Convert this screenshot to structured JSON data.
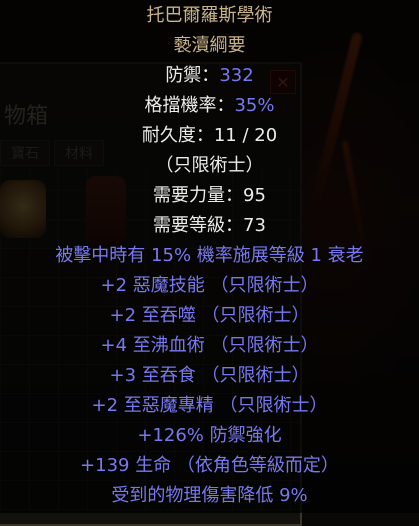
{
  "item": {
    "name": "托巴爾羅斯學術",
    "base_type": "褻瀆綱要",
    "defense_label": "防禦：",
    "defense_value": "332",
    "block_label": "格擋機率：",
    "block_value": "35%",
    "durability": "耐久度：11 / 20",
    "class_restriction": "（只限術士）",
    "required_strength": "需要力量：95",
    "required_level": "需要等級：73",
    "affixes": [
      "被擊中時有 15% 機率施展等級 1 衰老",
      "+2 惡魔技能 （只限術士）",
      "+2 至吞噬 （只限術士）",
      "+4 至沸血術 （只限術士）",
      "+3 至吞食 （只限術士）",
      "+2 至惡魔專精 （只限術士）",
      "+126% 防禦強化",
      "+139 生命 （依角色等級而定）",
      "受到的物理傷害降低 9%"
    ]
  },
  "stash": {
    "title_fragment": "物箱",
    "tab_labels": [
      "寶石",
      "材料"
    ]
  },
  "colors": {
    "unique_name": "#c9b38a",
    "magic_stat": "#7878f0",
    "base_stat": "#ececec"
  }
}
